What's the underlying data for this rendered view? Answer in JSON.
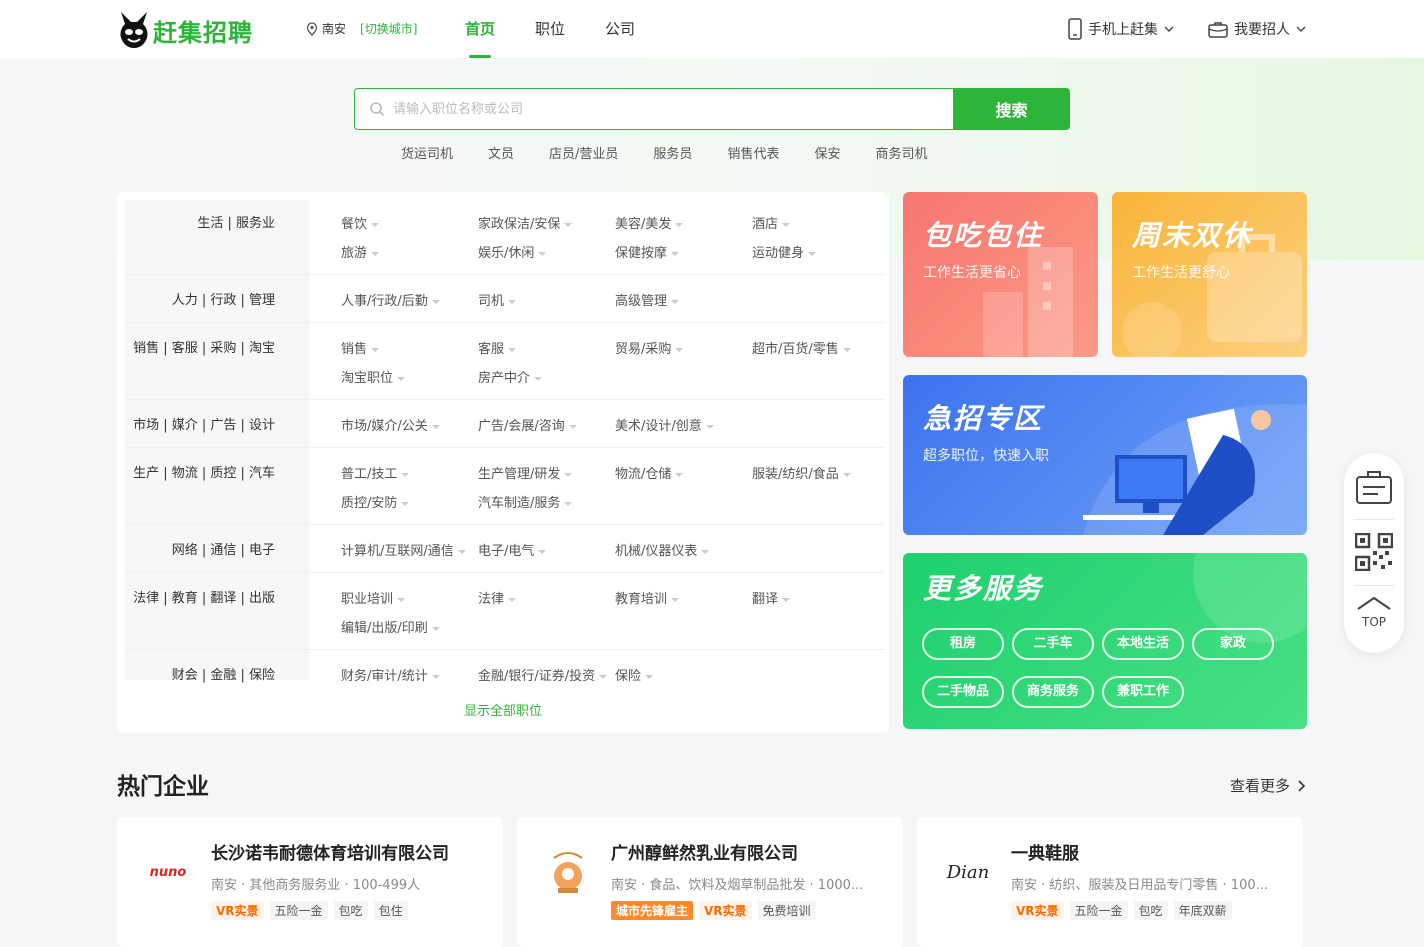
{
  "header": {
    "logo_text": "赶集招聘",
    "city": "南安",
    "city_switch": "[切换城市]",
    "nav": [
      "首页",
      "职位",
      "公司"
    ],
    "mobile_label": "手机上赶集",
    "recruit_label": "我要招人"
  },
  "search": {
    "placeholder": "请输入职位名称或公司",
    "button_label": "搜索",
    "hot_keywords": [
      "货运司机",
      "文员",
      "店员/营业员",
      "服务员",
      "销售代表",
      "保安",
      "商务司机"
    ]
  },
  "categories": [
    {
      "title": "生活 | 服务业",
      "items": [
        "餐饮",
        "家政保洁/安保",
        "美容/美发",
        "酒店",
        "旅游",
        "娱乐/休闲",
        "保健按摩",
        "运动健身"
      ]
    },
    {
      "title": "人力 | 行政 | 管理",
      "items": [
        "人事/行政/后勤",
        "司机",
        "高级管理"
      ]
    },
    {
      "title": "销售 | 客服 | 采购 | 淘宝",
      "items": [
        "销售",
        "客服",
        "贸易/采购",
        "超市/百货/零售",
        "淘宝职位",
        "房产中介"
      ]
    },
    {
      "title": "市场 | 媒介 | 广告 | 设计",
      "items": [
        "市场/媒介/公关",
        "广告/会展/咨询",
        "美术/设计/创意"
      ]
    },
    {
      "title": "生产 | 物流 | 质控 | 汽车",
      "items": [
        "普工/技工",
        "生产管理/研发",
        "物流/仓储",
        "服装/纺织/食品",
        "质控/安防",
        "汽车制造/服务"
      ]
    },
    {
      "title": "网络 | 通信 | 电子",
      "items": [
        "计算机/互联网/通信",
        "电子/电气",
        "机械/仪器仪表"
      ]
    },
    {
      "title": "法律 | 教育 | 翻译 | 出版",
      "items": [
        "职业培训",
        "法律",
        "教育培训",
        "翻译",
        "编辑/出版/印刷"
      ]
    },
    {
      "title": "财会 | 金融 | 保险",
      "items": [
        "财务/审计/统计",
        "金融/银行/证券/投资",
        "保险"
      ]
    }
  ],
  "show_all_label": "显示全部职位",
  "banners": {
    "b1": {
      "title": "包吃包住",
      "sub": "工作生活更省心"
    },
    "b2": {
      "title": "周末双休",
      "sub": "工作生活更舒心"
    },
    "b3": {
      "title": "急招专区",
      "sub": "超多职位，快速入职"
    },
    "b4": {
      "title": "更多服务",
      "services": [
        "租房",
        "二手车",
        "本地生活",
        "家政",
        "二手物品",
        "商务服务",
        "兼职工作"
      ]
    }
  },
  "side_tool": {
    "top_label": "TOP"
  },
  "hot_companies": {
    "title": "热门企业",
    "more_label": "查看更多",
    "items": [
      {
        "name": "长沙诺韦耐德体育培训有限公司",
        "meta": "南安 · 其他商务服务业 · 100-499人",
        "logo_text": "nuno",
        "tags": [
          "VR实景",
          "五险一金",
          "包吃",
          "包住"
        ]
      },
      {
        "name": "广州醇鲜然乳业有限公司",
        "meta": "南安 · 食品、饮料及烟草制品批发 · 1000...",
        "logo_text": "",
        "tags": [
          "城市先锋雇主",
          "VR实景",
          "免费培训"
        ]
      },
      {
        "name": "一典鞋服",
        "meta": "南安 · 纺织、服装及日用品专门零售 · 100...",
        "logo_text": "Dian",
        "tags": [
          "VR实景",
          "五险一金",
          "包吃",
          "年底双薪"
        ]
      }
    ]
  },
  "colors": {
    "brand": "#2db43a",
    "vr": "#ff6a00"
  }
}
